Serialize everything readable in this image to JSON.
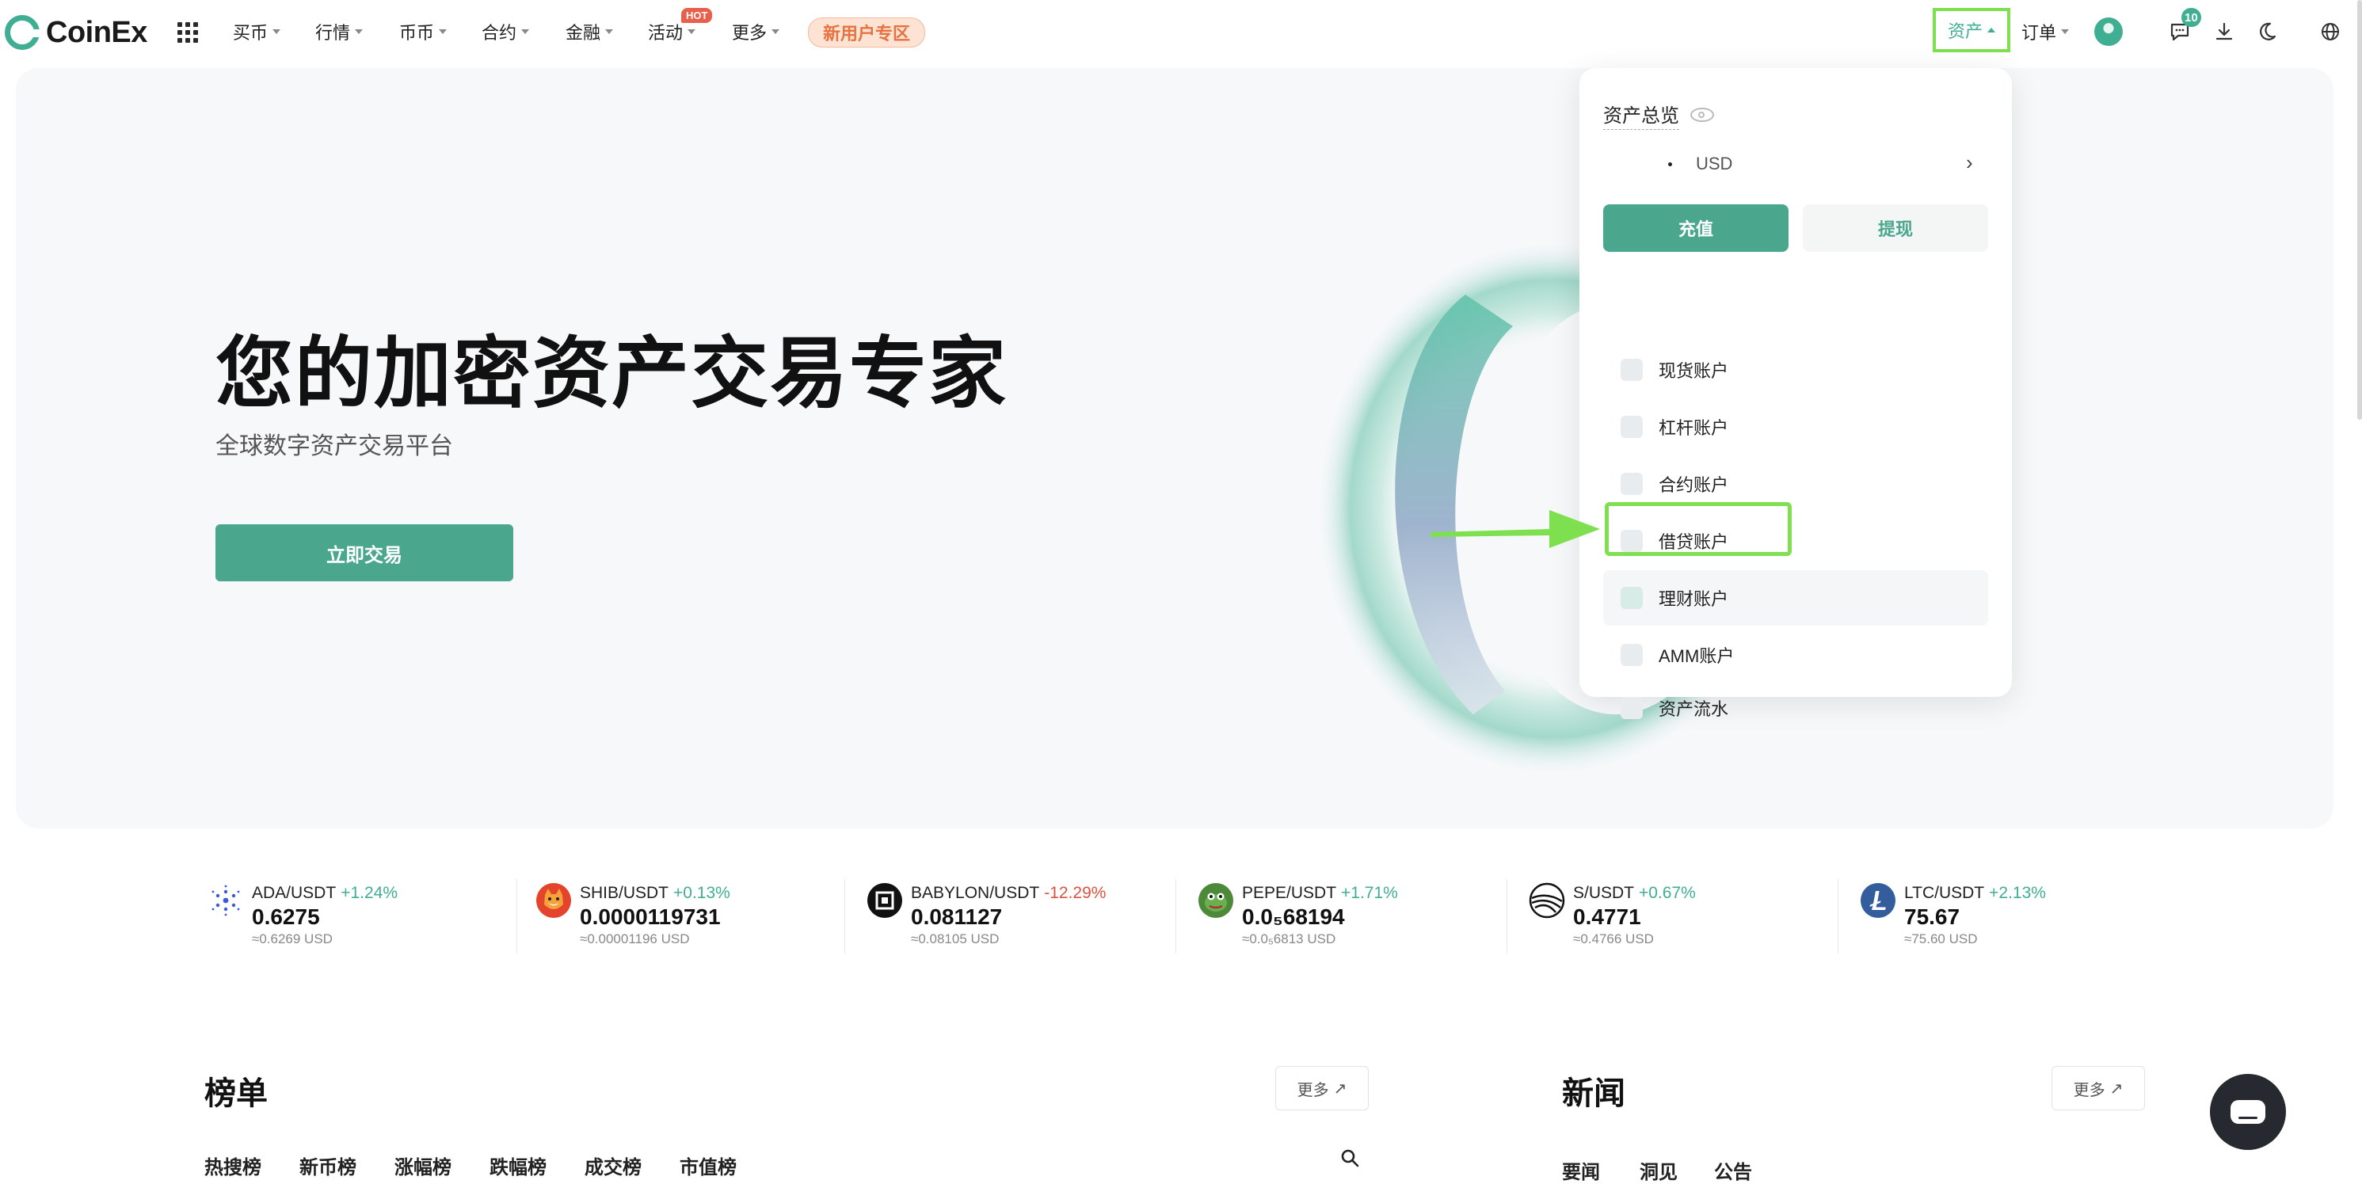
{
  "brand": {
    "name": "CoinEx"
  },
  "nav": {
    "items": [
      {
        "label": "买币"
      },
      {
        "label": "行情"
      },
      {
        "label": "币币"
      },
      {
        "label": "合约"
      },
      {
        "label": "金融"
      },
      {
        "label": "活动"
      },
      {
        "label": "更多"
      }
    ],
    "hot_badge": "HOT",
    "new_user": "新用户专区",
    "assets": "资产",
    "orders": "订单",
    "messages_count": "10"
  },
  "hero": {
    "title": "您的加密资产交易专家",
    "subtitle": "全球数字资产交易平台",
    "cta": "立即交易"
  },
  "assets_menu": {
    "title": "资产总览",
    "balance_currency": "USD",
    "deposit": "充值",
    "withdraw": "提现",
    "items": [
      {
        "label": "现货账户",
        "icon": "spot-wallet-icon"
      },
      {
        "label": "杠杆账户",
        "icon": "margin-percent-icon"
      },
      {
        "label": "合约账户",
        "icon": "futures-doc-icon"
      },
      {
        "label": "借贷账户",
        "icon": "loan-icon"
      },
      {
        "label": "理财账户",
        "icon": "financial-icon"
      },
      {
        "label": "AMM账户",
        "icon": "amm-monitor-icon"
      },
      {
        "label": "资产流水",
        "icon": "ledger-icon"
      }
    ],
    "highlighted_item": "理财账户"
  },
  "tickers": [
    {
      "pair": "ADA/USDT",
      "change": "+1.24%",
      "dir": "up",
      "price": "0.6275",
      "usd": "≈0.6269 USD",
      "color": "#3a5bd9"
    },
    {
      "pair": "SHIB/USDT",
      "change": "+0.13%",
      "dir": "up",
      "price": "0.0000119731",
      "usd": "≈0.00001196 USD",
      "color": "#e4442b"
    },
    {
      "pair": "BABYLON/USDT",
      "change": "-12.29%",
      "dir": "down",
      "price": "0.081127",
      "usd": "≈0.08105 USD",
      "color": "#111111"
    },
    {
      "pair": "PEPE/USDT",
      "change": "+1.71%",
      "dir": "up",
      "price": "0.0₅68194",
      "usd": "≈0.0₅6813 USD",
      "color": "#4c8a3a"
    },
    {
      "pair": "S/USDT",
      "change": "+0.67%",
      "dir": "up",
      "price": "0.4771",
      "usd": "≈0.4766 USD",
      "color": "#111111"
    },
    {
      "pair": "LTC/USDT",
      "change": "+2.13%",
      "dir": "up",
      "price": "75.67",
      "usd": "≈75.60 USD",
      "color": "#345d9d"
    }
  ],
  "rankings": {
    "title": "榜单",
    "more": "更多",
    "tabs": [
      "热搜榜",
      "新币榜",
      "涨幅榜",
      "跌幅榜",
      "成交榜",
      "市值榜"
    ]
  },
  "news": {
    "title": "新闻",
    "more": "更多",
    "tabs": [
      "要闻",
      "洞见",
      "公告"
    ]
  },
  "colors": {
    "accent": "#3fae92",
    "highlight": "#7ee04f",
    "down": "#e0523f"
  }
}
